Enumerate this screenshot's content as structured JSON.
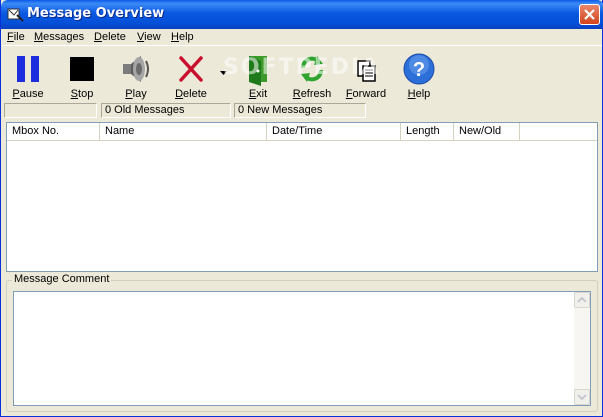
{
  "window": {
    "title": "Message Overview"
  },
  "menu": [
    "File",
    "Messages",
    "Delete",
    "View",
    "Help"
  ],
  "toolbar": {
    "pause": "Pause",
    "stop": "Stop",
    "play": "Play",
    "delete": "Delete",
    "exit": "Exit",
    "refresh": "Refresh",
    "forward": "Forward",
    "help": "Help"
  },
  "watermark": "SOFTPEDIA",
  "status": {
    "old_messages": "0 Old Messages",
    "new_messages": "0 New Messages"
  },
  "table": {
    "columns": [
      "Mbox No.",
      "Name",
      "Date/Time",
      "Length",
      "New/Old"
    ],
    "rows": []
  },
  "comment": {
    "label": "Message Comment",
    "value": ""
  },
  "icons": {
    "pause": "pause-icon",
    "stop": "stop-icon",
    "play": "speaker-icon",
    "delete": "red-x-icon",
    "exit": "green-exit-icon",
    "refresh": "green-refresh-icon",
    "forward": "documents-icon",
    "help": "blue-question-icon"
  }
}
